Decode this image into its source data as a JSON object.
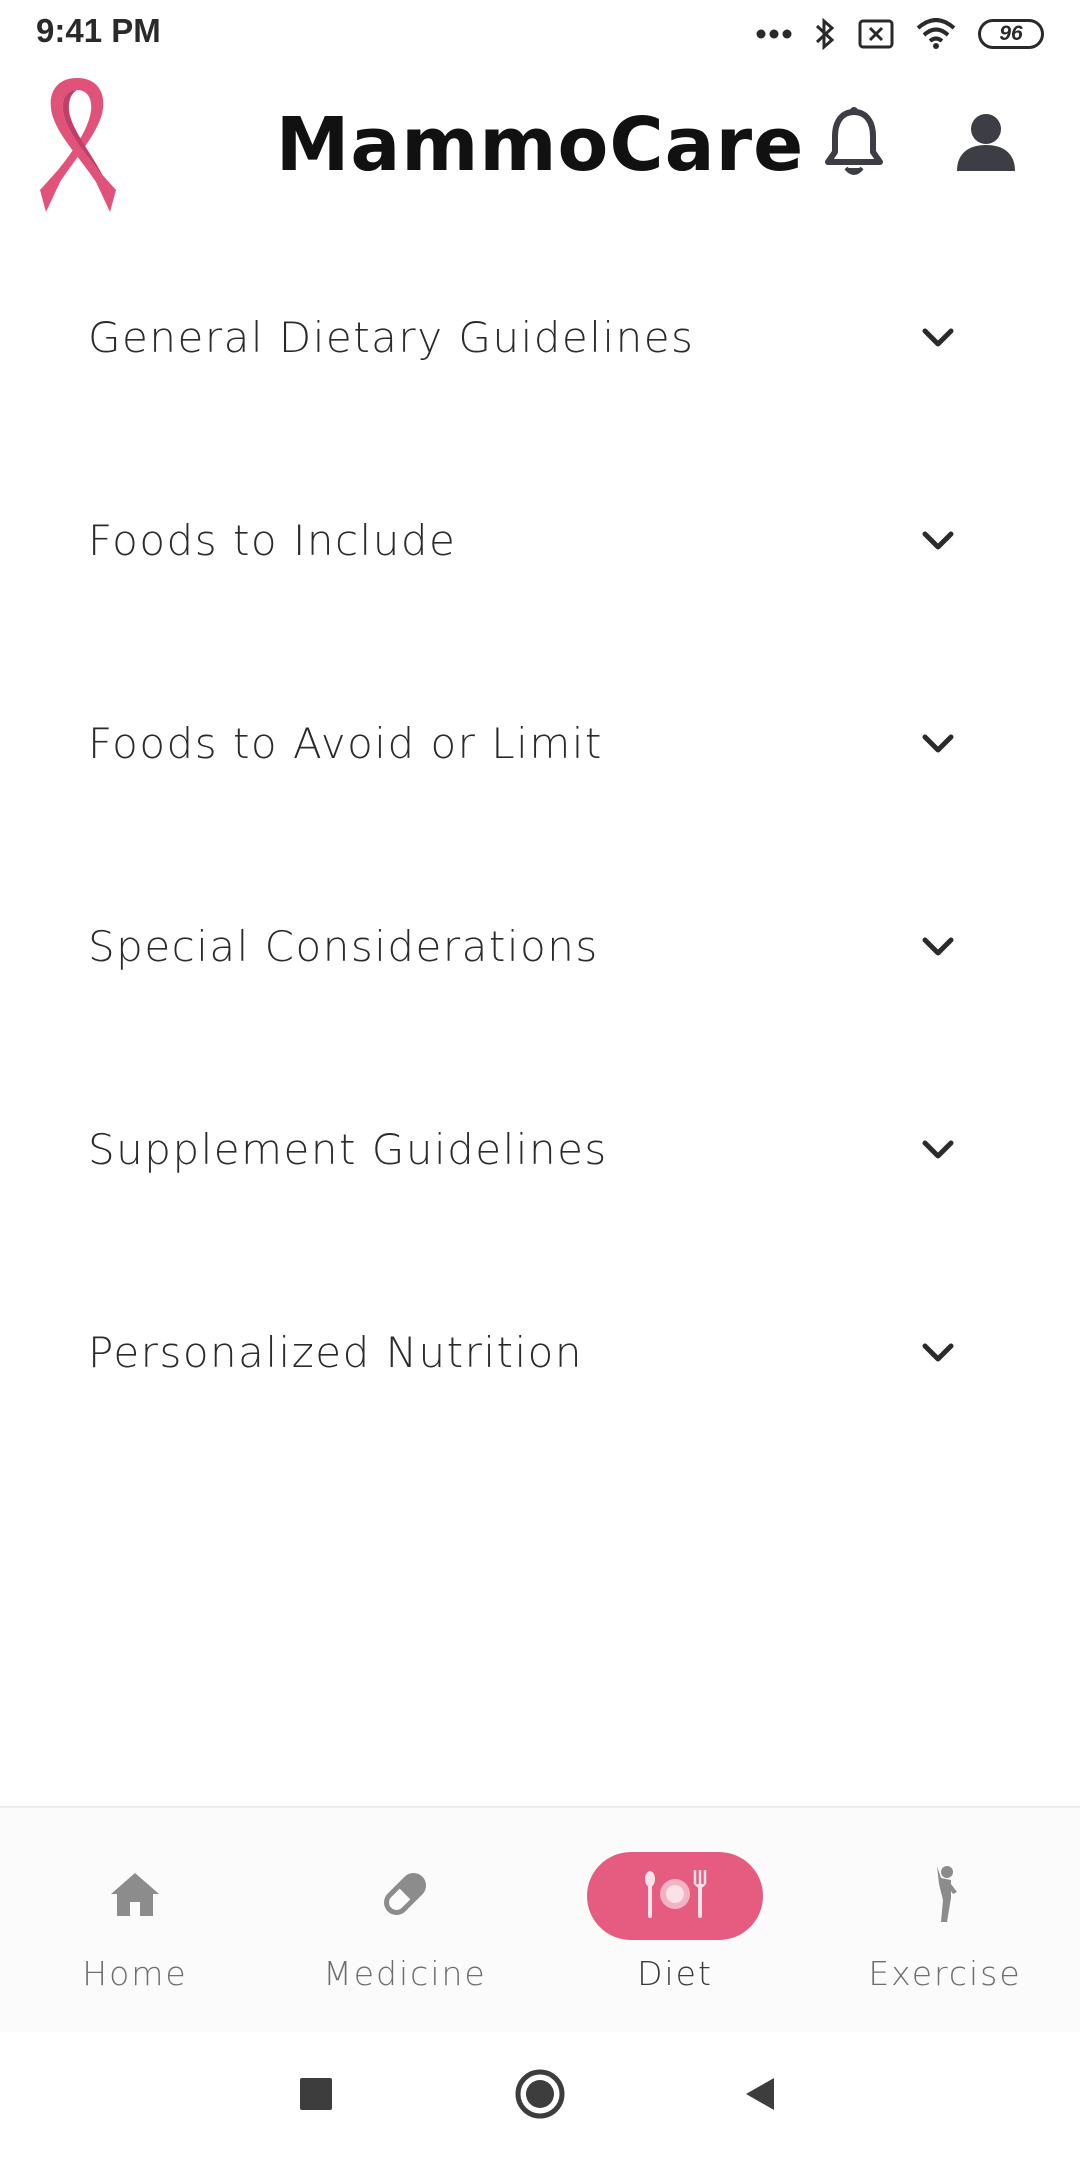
{
  "status_bar": {
    "time": "9:41 PM",
    "battery_level": "96",
    "icons": [
      "signal-dots-icon",
      "bluetooth-icon",
      "no-sim-icon",
      "wifi-icon",
      "battery-icon"
    ]
  },
  "header": {
    "title": "MammoCare",
    "logo": "pink-ribbon-logo",
    "notification_icon": "bell-icon",
    "profile_icon": "user-icon"
  },
  "sections": [
    {
      "label": "General Dietary Guidelines",
      "expanded": false
    },
    {
      "label": "Foods to Include",
      "expanded": false
    },
    {
      "label": "Foods to Avoid or Limit",
      "expanded": false
    },
    {
      "label": "Special Considerations",
      "expanded": false
    },
    {
      "label": "Supplement Guidelines",
      "expanded": false
    },
    {
      "label": "Personalized Nutrition",
      "expanded": false
    }
  ],
  "bottom_nav": {
    "items": [
      {
        "label": "Home",
        "icon": "home-icon",
        "active": false
      },
      {
        "label": "Medicine",
        "icon": "pill-icon",
        "active": false
      },
      {
        "label": "Diet",
        "icon": "diet-icon",
        "active": true
      },
      {
        "label": "Exercise",
        "icon": "exercise-icon",
        "active": false
      }
    ]
  },
  "system_nav": {
    "buttons": [
      "recents-button",
      "home-button",
      "back-button"
    ]
  },
  "colors": {
    "accent": "#e65c80",
    "ribbon": "#e0527a",
    "icon_dark": "#3d3d45",
    "nav_icon_inactive": "#8c8c8c"
  }
}
